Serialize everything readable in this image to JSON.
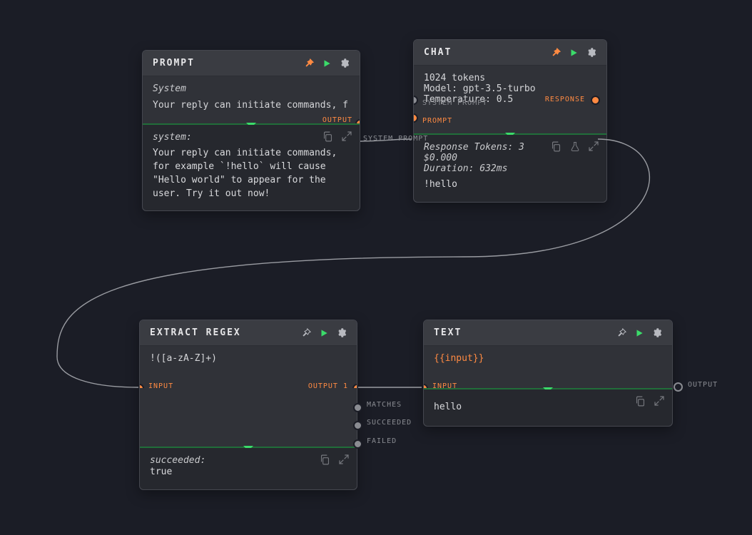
{
  "colors": {
    "accent_orange": "#ff8a42",
    "accent_green": "#3bdc6a",
    "bg": "#1b1d26",
    "card": "#303238",
    "card_header": "#3a3c42",
    "muted": "#8a8c92"
  },
  "icons": {
    "pin": "pin-icon",
    "play": "play-icon",
    "gear": "gear-icon",
    "copy": "copy-icon",
    "expand": "expand-icon",
    "flask": "flask-icon"
  },
  "nodes": {
    "prompt": {
      "title": "PROMPT",
      "pinned": true,
      "system_label": "System",
      "preview_line": "Your reply can initiate commands, f",
      "ports": {
        "output": "OUTPUT"
      },
      "result": {
        "label": "system:",
        "text": "Your reply can initiate commands, for example `!hello` will cause \"Hello world\" to appear for the user. Try it out now!"
      }
    },
    "chat": {
      "title": "CHAT",
      "pinned": true,
      "config_lines": [
        "1024 tokens",
        "Model: gpt-3.5-turbo",
        "Temperature: 0.5"
      ],
      "ports": {
        "system_prompt": "SYSTEM PROMPT",
        "prompt": "PROMPT",
        "response": "RESPONSE"
      },
      "result": {
        "meta_lines": [
          "Response Tokens: 3",
          "$0.000",
          "Duration: 632ms"
        ],
        "text": "!hello"
      }
    },
    "extract": {
      "title": "EXTRACT REGEX",
      "pinned": false,
      "pattern": "!([a-zA-Z]+)",
      "ports": {
        "input": "INPUT",
        "output1": "OUTPUT 1",
        "matches": "MATCHES",
        "succeeded": "SUCCEEDED",
        "failed": "FAILED"
      },
      "result": {
        "label": "succeeded:",
        "text": "true"
      }
    },
    "text": {
      "title": "TEXT",
      "pinned": false,
      "template": "{{input}}",
      "ports": {
        "input": "INPUT",
        "output": "OUTPUT"
      },
      "result_text": "hello"
    }
  }
}
